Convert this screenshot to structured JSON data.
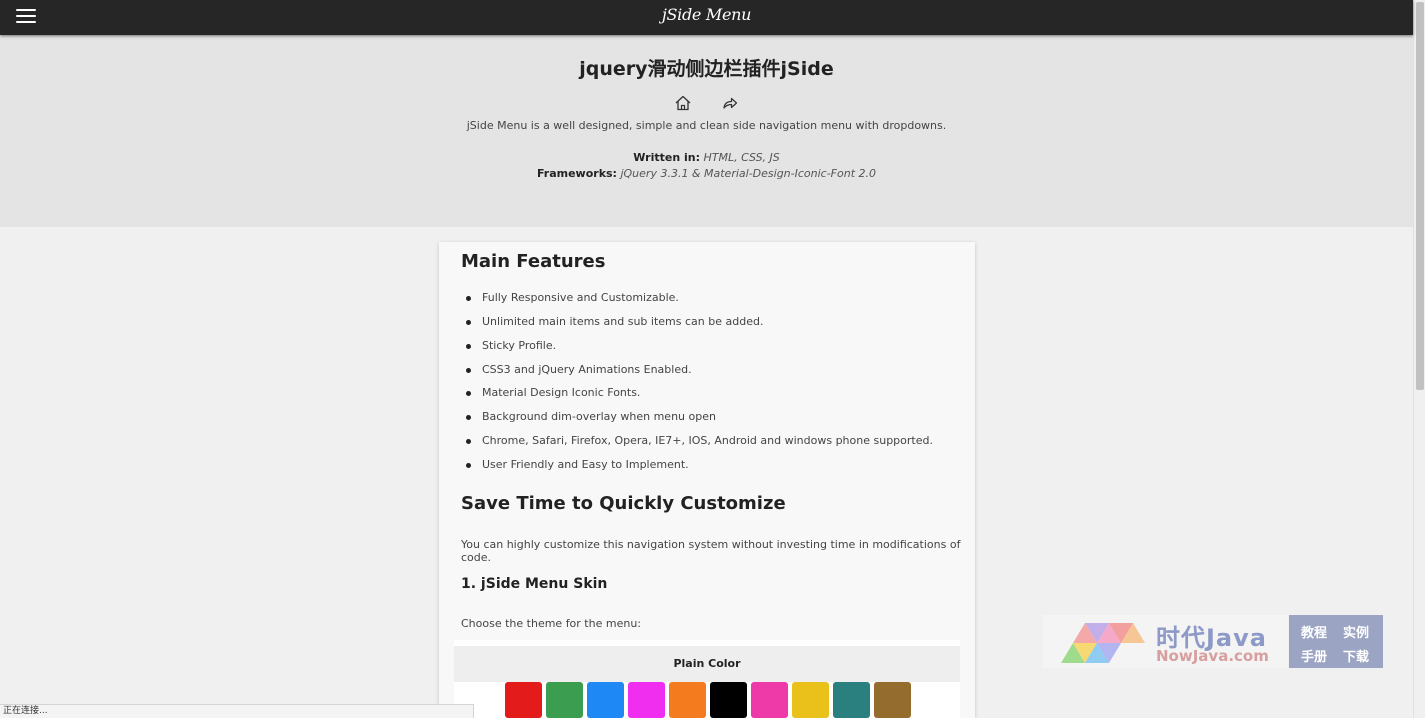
{
  "header": {
    "title": "jSide Menu"
  },
  "hero": {
    "title": "jquery滑动侧边栏插件jSide",
    "icons": [
      "home-icon",
      "share-icon"
    ],
    "description": "jSide Menu is a well designed, simple and clean side navigation menu with dropdowns.",
    "written_label": "Written in:",
    "written_value": "HTML, CSS, JS",
    "frameworks_label": "Frameworks:",
    "frameworks_value": "jQuery 3.3.1 & Material-Design-Iconic-Font 2.0"
  },
  "content": {
    "features_heading": "Main Features",
    "features": [
      "Fully Responsive and Customizable.",
      "Unlimited main items and sub items can be added.",
      "Sticky Profile.",
      "CSS3 and jQuery Animations Enabled.",
      "Material Design Iconic Fonts.",
      "Background dim-overlay when menu open",
      "Chrome, Safari, Firefox, Opera, IE7+, IOS, Android and windows phone supported.",
      "User Friendly and Easy to Implement."
    ],
    "customize_heading": "Save Time to Quickly Customize",
    "customize_text": "You can highly customize this navigation system without investing time in modifications of code.",
    "skin_heading": "1. jSide Menu Skin",
    "skin_text": "Choose the theme for the menu:",
    "plain_color_label": "Plain Color",
    "swatch_colors": [
      "#e31b1b",
      "#3a9d4f",
      "#1e88f5",
      "#ef2ef0",
      "#f57c1e",
      "#000000",
      "#ee3aa8",
      "#e9c11a",
      "#2a7f7f",
      "#946c2e"
    ]
  },
  "status": {
    "text": "正在连接..."
  },
  "watermark": {
    "cn_name": "时代Java",
    "domain": "NowJava.com",
    "links": [
      "教程",
      "实例",
      "手册",
      "下载"
    ]
  },
  "colors": {
    "topbar": "#262626",
    "hero_bg": "#e4e4e4",
    "page_bg": "#f0f0f0",
    "card_bg": "#f8f8f8"
  }
}
